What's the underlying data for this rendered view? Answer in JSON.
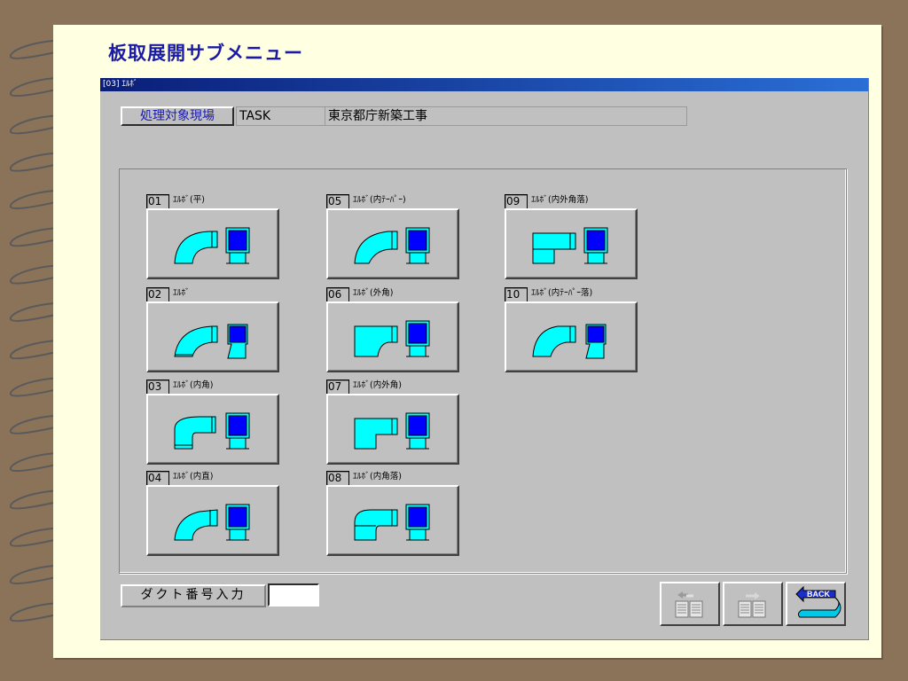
{
  "page": {
    "title": "板取展開サブメニュー"
  },
  "window": {
    "title": "[03] ｴﾙﾎﾞ"
  },
  "header": {
    "label": "処理対象現場",
    "code": "TASK",
    "name": "東京都庁新築工事"
  },
  "items": [
    {
      "num": "01",
      "label": "ｴﾙﾎﾞ(平)",
      "shape": "elbow-flat-icon"
    },
    {
      "num": "02",
      "label": "ｴﾙﾎﾞ",
      "shape": "elbow-icon"
    },
    {
      "num": "03",
      "label": "ｴﾙﾎﾞ(内角)",
      "shape": "elbow-inner-corner-icon"
    },
    {
      "num": "04",
      "label": "ｴﾙﾎﾞ(内直)",
      "shape": "elbow-inner-straight-icon"
    },
    {
      "num": "05",
      "label": "ｴﾙﾎﾞ(内ﾃｰﾊﾟｰ)",
      "shape": "elbow-inner-taper-icon"
    },
    {
      "num": "06",
      "label": "ｴﾙﾎﾞ(外角)",
      "shape": "elbow-outer-corner-icon"
    },
    {
      "num": "07",
      "label": "ｴﾙﾎﾞ(内外角)",
      "shape": "elbow-inner-outer-corner-icon"
    },
    {
      "num": "08",
      "label": "ｴﾙﾎﾞ(内角落)",
      "shape": "elbow-inner-corner-drop-icon"
    },
    {
      "num": "09",
      "label": "ｴﾙﾎﾞ(内外角落)",
      "shape": "elbow-inner-outer-corner-drop-icon"
    },
    {
      "num": "10",
      "label": "ｴﾙﾎﾞ(内ﾃｰﾊﾟｰ落)",
      "shape": "elbow-inner-taper-drop-icon"
    }
  ],
  "footer": {
    "duct_label": "ダクト番号入力",
    "duct_value": "",
    "back_label": "BACK"
  },
  "icons": {
    "prev": "page-prev-icon",
    "next": "page-next-icon",
    "back": "back-arrow-icon"
  },
  "colors": {
    "duct_fill": "#00ffff",
    "duct_section": "#0000ff",
    "title": "#1a1aa6",
    "window_bg": "#c0c0c0"
  }
}
